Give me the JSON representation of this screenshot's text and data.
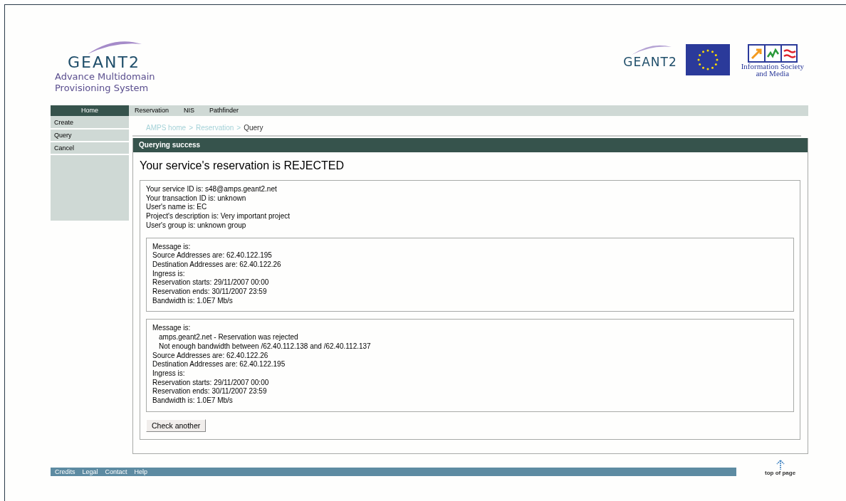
{
  "header": {
    "logo": {
      "title": "GEANT2",
      "subtitle": [
        "Advance Multidomain",
        "Provisioning System"
      ]
    },
    "partner_logos": [
      {
        "kind": "geant",
        "text": "GEANT2"
      },
      {
        "kind": "eu_flag"
      },
      {
        "kind": "ist",
        "lines": [
          "Information Society",
          "and Media"
        ]
      }
    ]
  },
  "nav": {
    "home": {
      "label": "Home",
      "selected": true
    },
    "tabs": [
      {
        "label": "Reservation",
        "selected": false
      },
      {
        "label": "NIS",
        "selected": false
      },
      {
        "label": "Pathfinder",
        "selected": false
      }
    ]
  },
  "sidebar": {
    "items": [
      {
        "label": "Create"
      },
      {
        "label": "Query"
      },
      {
        "label": "Cancel"
      }
    ]
  },
  "breadcrumb": {
    "links": [
      "AMPS home",
      "Reservation"
    ],
    "separator": ">",
    "current": "Query"
  },
  "panel": {
    "title": "Querying success",
    "heading": "Your service's reservation is REJECTED",
    "info": [
      "Your service ID is: s48@amps.geant2.net",
      "Your transaction ID is: unknown",
      "User's name is: EC",
      "Project's description is: Very important project",
      "User's group is: unknown group"
    ],
    "messages": [
      {
        "lines": [
          {
            "kind": "plain",
            "text": "Message is:"
          },
          {
            "kind": "plain",
            "text": "Source Addresses are: 62.40.122.195"
          },
          {
            "kind": "plain",
            "text": "Destination Addresses are: 62.40.122.26"
          },
          {
            "kind": "plain",
            "text": "Ingress is:"
          },
          {
            "kind": "plain",
            "text": "Reservation starts: 29/11/2007 00:00"
          },
          {
            "kind": "plain",
            "text": "Reservation ends: 30/11/2007 23:59"
          },
          {
            "kind": "plain",
            "text": "Bandwidth is: 1.0E7 Mb/s"
          }
        ]
      },
      {
        "lines": [
          {
            "kind": "plain",
            "text": "Message is:"
          },
          {
            "kind": "indent",
            "text": "amps.geant2.net - Reservation was rejected"
          },
          {
            "kind": "indent",
            "text": "Not enough bandwidth between /62.40.112.138 and /62.40.112.137"
          },
          {
            "kind": "plain",
            "text": "Source Addresses are: 62.40.122.26"
          },
          {
            "kind": "plain",
            "text": "Destination Addresses are: 62.40.122.195"
          },
          {
            "kind": "plain",
            "text": "Ingress is:"
          },
          {
            "kind": "plain",
            "text": "Reservation starts: 29/11/2007 00:00"
          },
          {
            "kind": "plain",
            "text": "Reservation ends: 30/11/2007 23:59"
          },
          {
            "kind": "plain",
            "text": "Bandwidth is: 1.0E7 Mb/s"
          }
        ]
      }
    ],
    "button": "Check another"
  },
  "footer": {
    "links": [
      "Credits",
      "Legal",
      "Contact",
      "Help"
    ],
    "top_link": "top of page"
  }
}
